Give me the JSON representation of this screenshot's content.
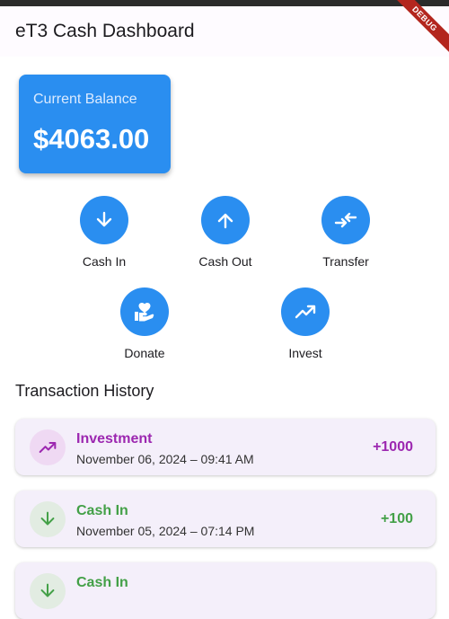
{
  "app": {
    "title": "eT3 Cash Dashboard",
    "debug_label": "DEBUG"
  },
  "balance": {
    "label": "Current Balance",
    "value": "$4063.00"
  },
  "actions": [
    {
      "label": "Cash In",
      "icon": "arrow-down-icon"
    },
    {
      "label": "Cash Out",
      "icon": "arrow-up-icon"
    },
    {
      "label": "Transfer",
      "icon": "transfer-icon"
    },
    {
      "label": "Donate",
      "icon": "donate-icon"
    },
    {
      "label": "Invest",
      "icon": "trending-up-icon"
    }
  ],
  "history": {
    "title": "Transaction History",
    "items": [
      {
        "title": "Investment",
        "date": "November 06, 2024 – 09:41 AM",
        "amount": "+1000",
        "color": "#9c27b0",
        "icon": "trending-up-icon"
      },
      {
        "title": "Cash In",
        "date": "November 05, 2024 – 07:14 PM",
        "amount": "+100",
        "color": "#43a047",
        "icon": "arrow-down-icon"
      },
      {
        "title": "Cash In",
        "date": "",
        "amount": "",
        "color": "#43a047",
        "icon": "arrow-down-icon"
      }
    ]
  },
  "colors": {
    "primary": "#2a8ef0",
    "investment": "#9c27b0",
    "cash_in": "#43a047"
  }
}
